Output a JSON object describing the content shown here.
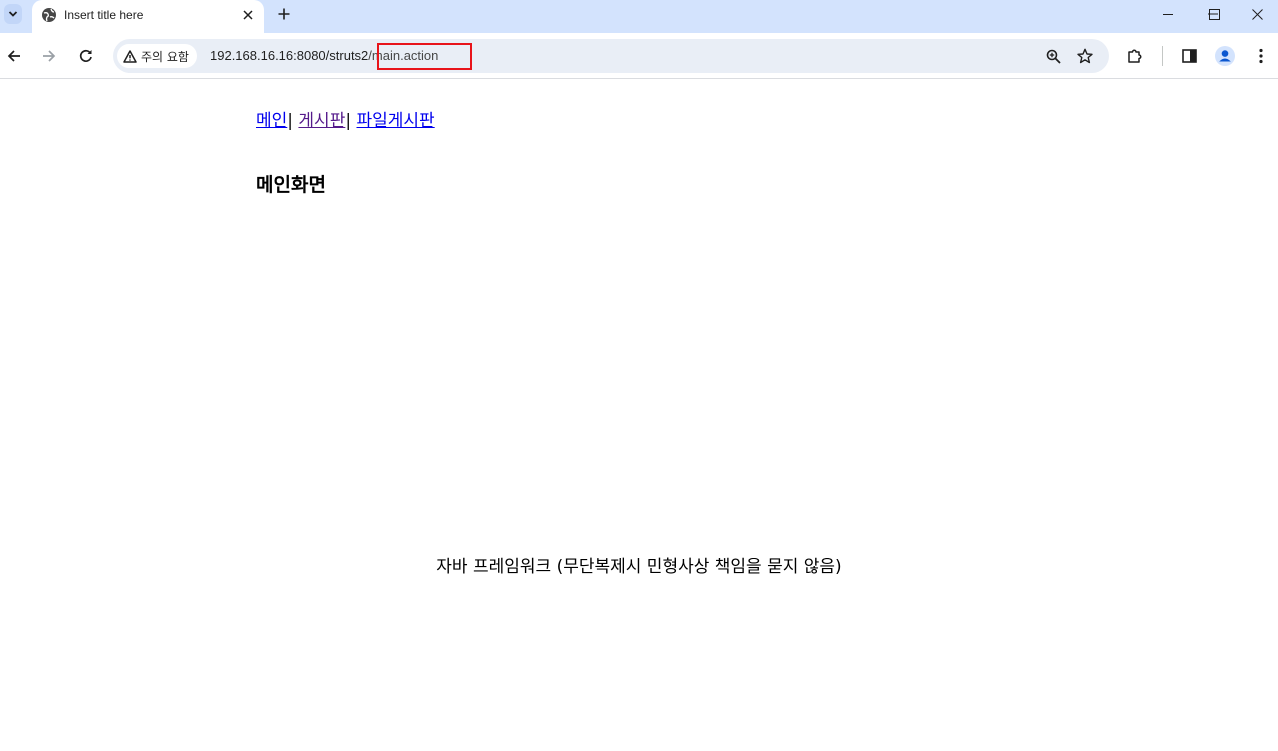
{
  "browser": {
    "tab": {
      "title": "Insert title here",
      "favicon": "globe-icon",
      "close_icon": "close-icon"
    },
    "new_tab_icon": "plus-icon",
    "tab_search_icon": "chevron-down-icon",
    "window_controls": [
      "minimize-icon",
      "maximize-icon",
      "close-icon"
    ],
    "toolbar": {
      "back_icon": "arrow-left-icon",
      "forward_icon": "arrow-right-icon",
      "reload_icon": "reload-icon",
      "security_chip": {
        "icon": "warning-icon",
        "label": "주의 요함"
      },
      "url": {
        "host": "192.168.16.16:8080/struts2",
        "path": "/main.action"
      },
      "zoom_icon": "zoom-icon",
      "bookmark_icon": "star-icon",
      "extensions_icon": "puzzle-icon",
      "side_panel_icon": "side-panel-icon",
      "profile_icon": "profile-icon",
      "menu_icon": "kebab-menu-icon"
    },
    "highlight_color": "#e8131a"
  },
  "page": {
    "nav": {
      "items": [
        {
          "label": "메인"
        },
        {
          "label": "게시판"
        },
        {
          "label": "파일게시판"
        }
      ],
      "separator": "|"
    },
    "heading": "메인화면",
    "footer": "자바 프레임워크 (무단복제시 민형사상 책임을 묻지 않음)"
  }
}
